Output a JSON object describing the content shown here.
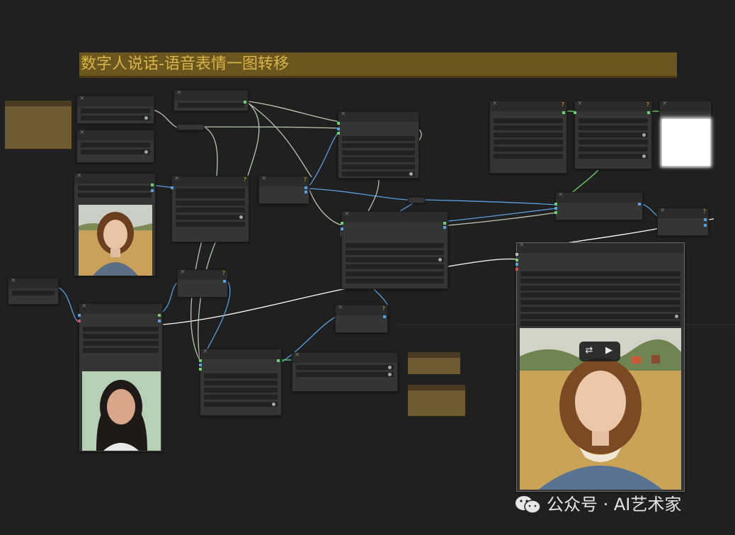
{
  "workflow": {
    "group_title": "数字人说话-语音表情一图转移"
  },
  "preview": {
    "controls": {
      "swap_icon": "swap-icon",
      "play_icon": "video-play-icon"
    }
  },
  "watermark": {
    "text": "公众号 · AI艺术家",
    "icon": "wechat-icon"
  },
  "colors": {
    "background": "#202020",
    "group": "#6b5620",
    "group_text": "#d8b448",
    "node": "#353535",
    "wire_blue": "#5a9fe0",
    "wire_light": "#b7c7b0",
    "port_green": "#6ed06e"
  }
}
